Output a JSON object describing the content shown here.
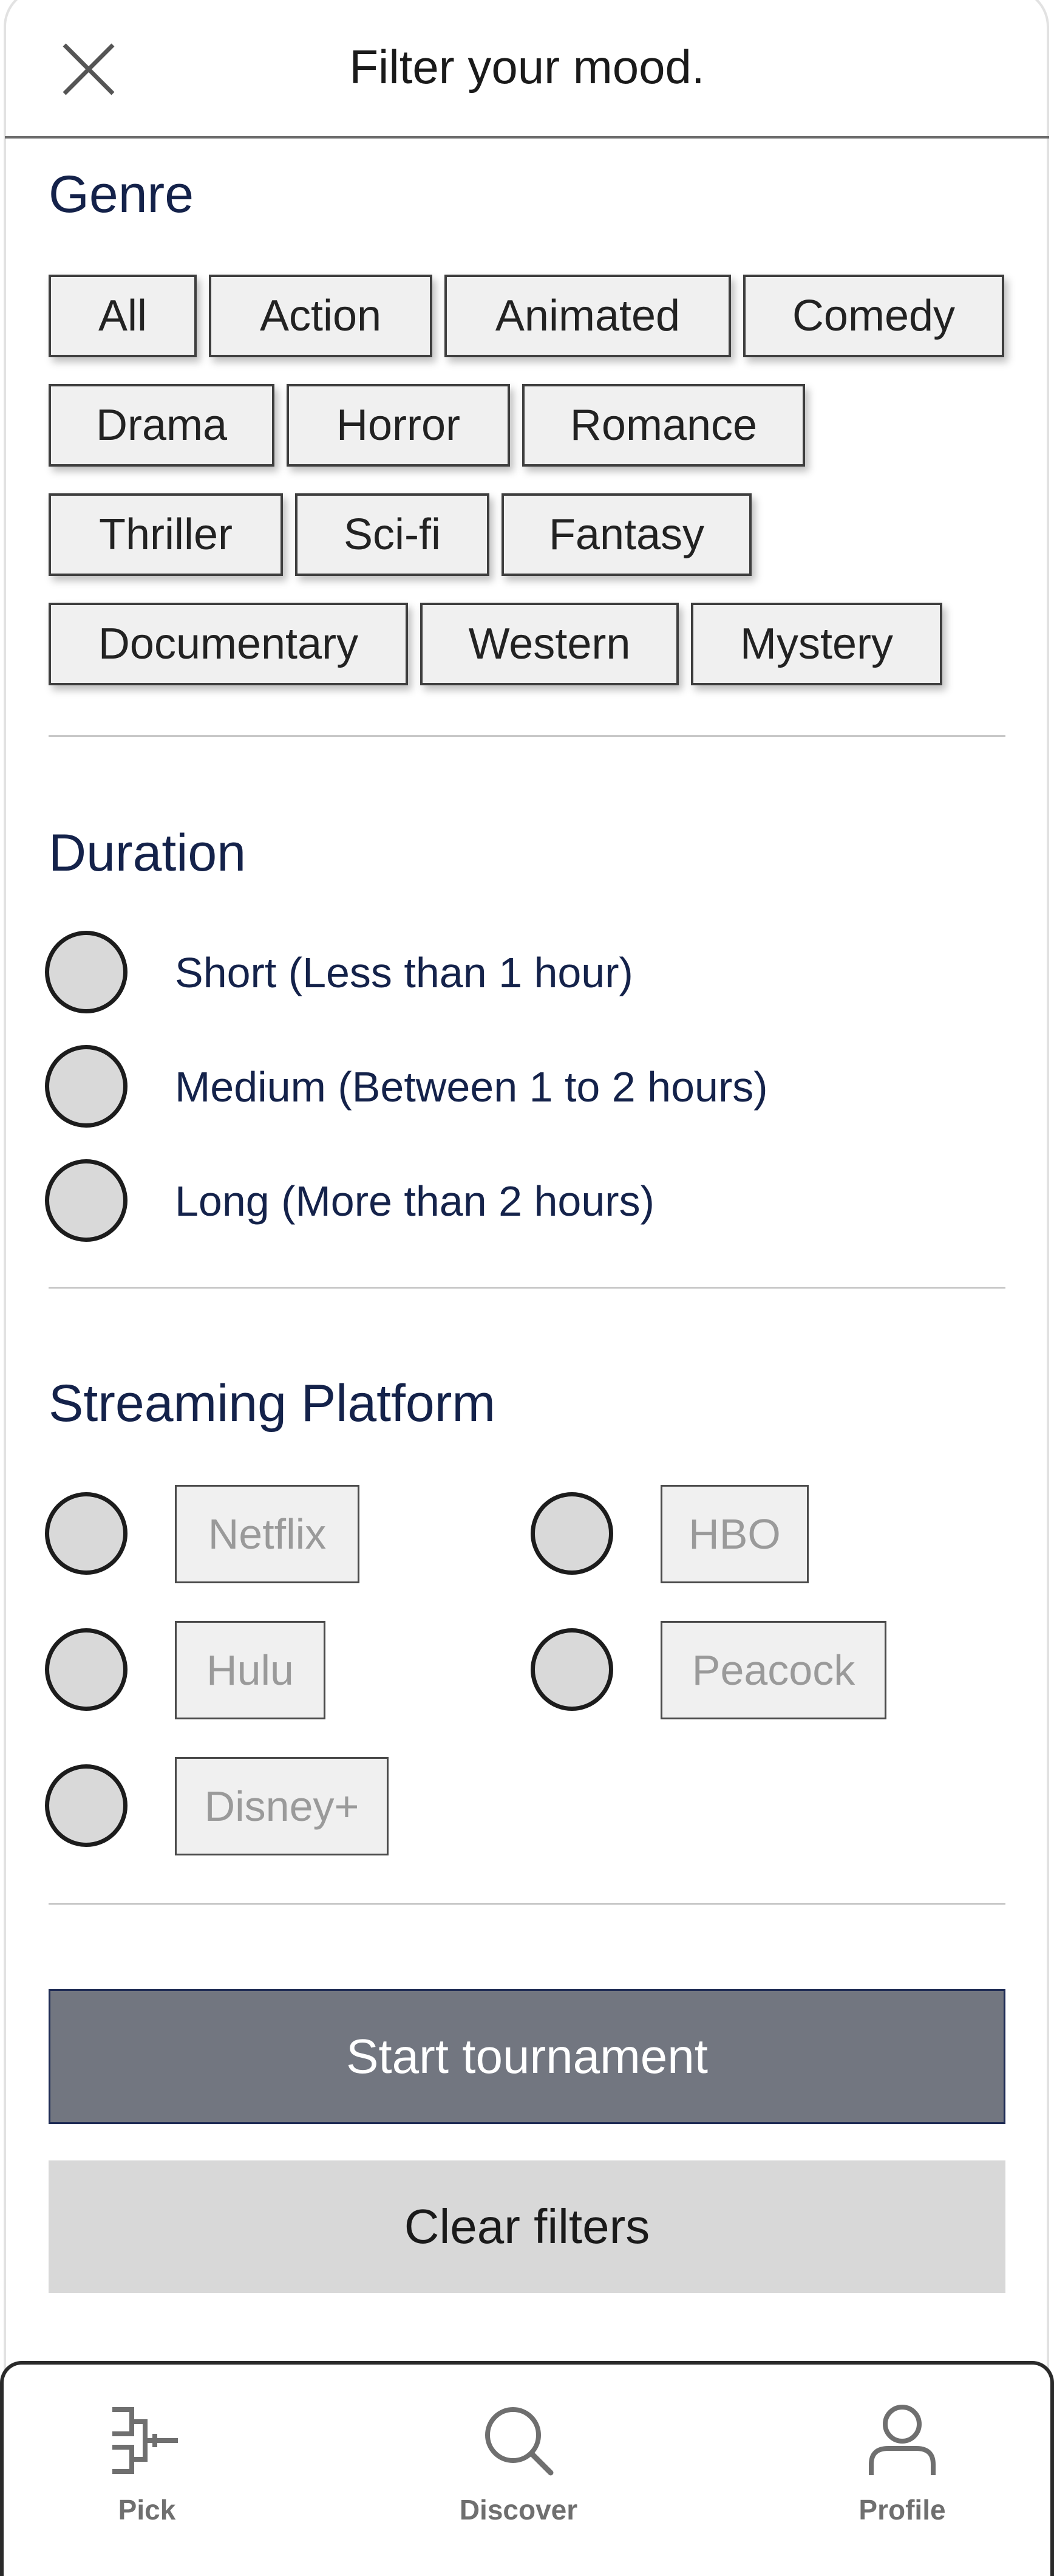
{
  "header": {
    "title": "Filter your mood."
  },
  "genre": {
    "title": "Genre",
    "rows": [
      [
        "All",
        "Action",
        "Animated",
        "Comedy"
      ],
      [
        "Drama",
        "Horror",
        "Romance"
      ],
      [
        "Thriller",
        "Sci-fi",
        "Fantasy"
      ],
      [
        "Documentary",
        "Western",
        "Mystery"
      ]
    ]
  },
  "duration": {
    "title": "Duration",
    "options": [
      "Short (Less than 1 hour)",
      "Medium (Between 1 to 2 hours)",
      "Long (More than 2 hours)"
    ]
  },
  "platform": {
    "title": "Streaming Platform",
    "options": [
      "Netflix",
      "HBO",
      "Hulu",
      "Peacock",
      "Disney+"
    ]
  },
  "actions": {
    "start": "Start tournament",
    "clear": "Clear filters"
  },
  "nav": {
    "pick": "Pick",
    "discover": "Discover",
    "profile": "Profile"
  },
  "colors": {
    "heading": "#14224a",
    "primary_button": "#727680",
    "secondary_button": "#d8d8d8"
  }
}
